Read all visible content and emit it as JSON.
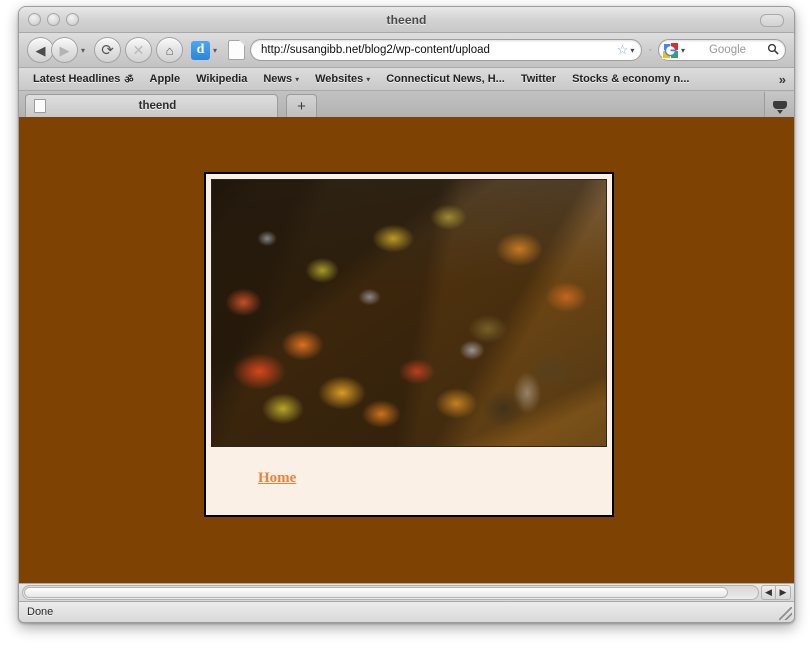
{
  "window": {
    "title": "theend",
    "traffic_lights": [
      "close",
      "minimize",
      "zoom"
    ],
    "toolbar_toggle": "toolbar-toggle"
  },
  "toolbar": {
    "back_icon": "◀",
    "forward_icon": "▶",
    "nav_dropdown_icon": "▾",
    "reload_icon": "⟳",
    "stop_icon": "✕",
    "home_icon": "⌂",
    "diigo_label": "d",
    "diigo_dropdown_icon": "▾",
    "url_value": "http://susangibb.net/blog2/wp-content/upload",
    "bookmark_star_icon": "☆",
    "url_dropdown_icon": "▾",
    "separator_dot": "·",
    "search_engine": "Google",
    "search_placeholder": "Google",
    "search_dropdown_icon": "▾",
    "search_magnifier_icon": "⚲"
  },
  "bookmarks": {
    "items": [
      {
        "label": "Latest Headlines",
        "rss": "ॐ",
        "has_rss": true,
        "has_caret": false
      },
      {
        "label": "Apple",
        "has_caret": false
      },
      {
        "label": "Wikipedia",
        "has_caret": false
      },
      {
        "label": "News",
        "has_caret": true,
        "caret": "▾"
      },
      {
        "label": "Websites",
        "has_caret": true,
        "caret": "▾"
      },
      {
        "label": "Connecticut News, H...",
        "has_caret": false
      },
      {
        "label": "Twitter",
        "has_caret": false
      },
      {
        "label": "Stocks & economy n...",
        "has_caret": false
      }
    ],
    "overflow_icon": "»"
  },
  "tabs": {
    "active_tab_title": "theend",
    "new_tab_icon": "+",
    "tab_list_icon": "tab-list"
  },
  "page": {
    "background_color": "#7e4203",
    "card_border_color": "#000000",
    "card_background": "#faf0e6",
    "photo_alt": "autumn foliage tree with orange red and yellow leaves",
    "home_link_label": "Home",
    "home_link_color": "#e8843a"
  },
  "scrollbar": {
    "left_arrow_icon": "◀",
    "right_arrow_icon": "▶"
  },
  "status": {
    "text": "Done",
    "resize_grip": "resize-grip"
  }
}
